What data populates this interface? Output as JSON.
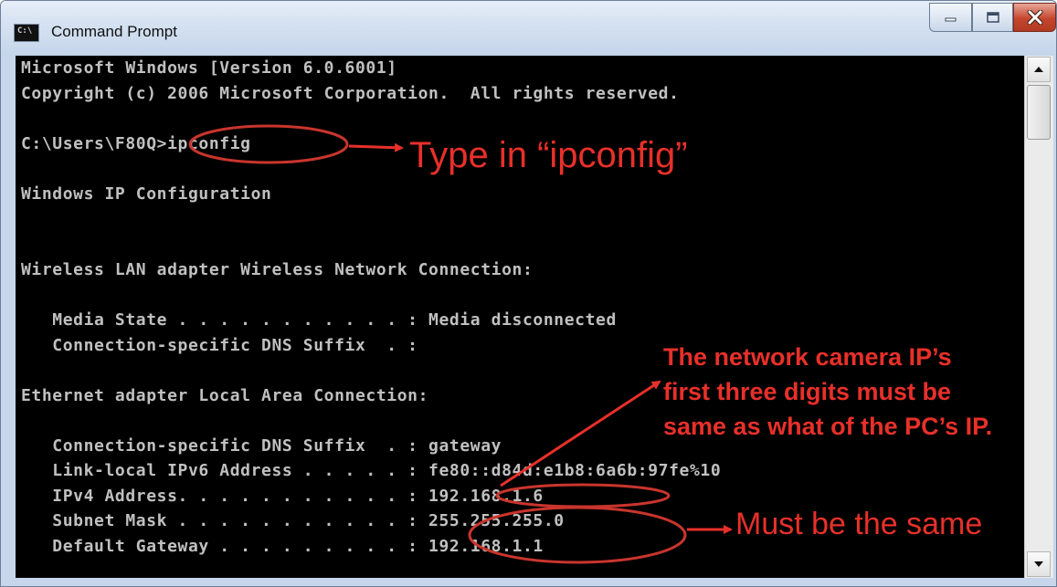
{
  "window": {
    "title": "Command Prompt",
    "icon": "cmd-icon",
    "controls": [
      "minimize-icon",
      "maximize-icon",
      "close-icon"
    ]
  },
  "console": {
    "lines": [
      "Microsoft Windows [Version 6.0.6001]",
      "Copyright (c) 2006 Microsoft Corporation.  All rights reserved.",
      "C:\\Users\\F80Q>ipconfig",
      "Windows IP Configuration",
      "Wireless LAN adapter Wireless Network Connection:",
      "   Media State . . . . . . . . . . . : Media disconnected",
      "   Connection-specific DNS Suffix  . :",
      "Ethernet adapter Local Area Connection:",
      "   Connection-specific DNS Suffix  . : gateway",
      "   Link-local IPv6 Address . . . . . : fe80::d84d:e1b8:6a6b:97fe%10",
      "   IPv4 Address. . . . . . . . . . . : 192.168.1.6",
      "   Subnet Mask . . . . . . . . . . . : 255.255.255.0",
      "   Default Gateway . . . . . . . . . : 192.168.1.1"
    ]
  },
  "annotations": {
    "type_in": "Type in “ipconfig”",
    "note_lines": [
      "The network camera IP’s",
      "first three digits must be",
      "same as what of the PC’s IP."
    ],
    "must_be_same": "Must be the same",
    "color": "#e8302a"
  },
  "colors": {
    "console_bg": "#000000",
    "console_text": "#c0c0c0",
    "titlebar": "#d4e1f1",
    "close_button": "#c5452d"
  },
  "scrollbar": {
    "up_icon": "scroll-up-arrow-icon",
    "down_icon": "scroll-down-arrow-icon"
  }
}
